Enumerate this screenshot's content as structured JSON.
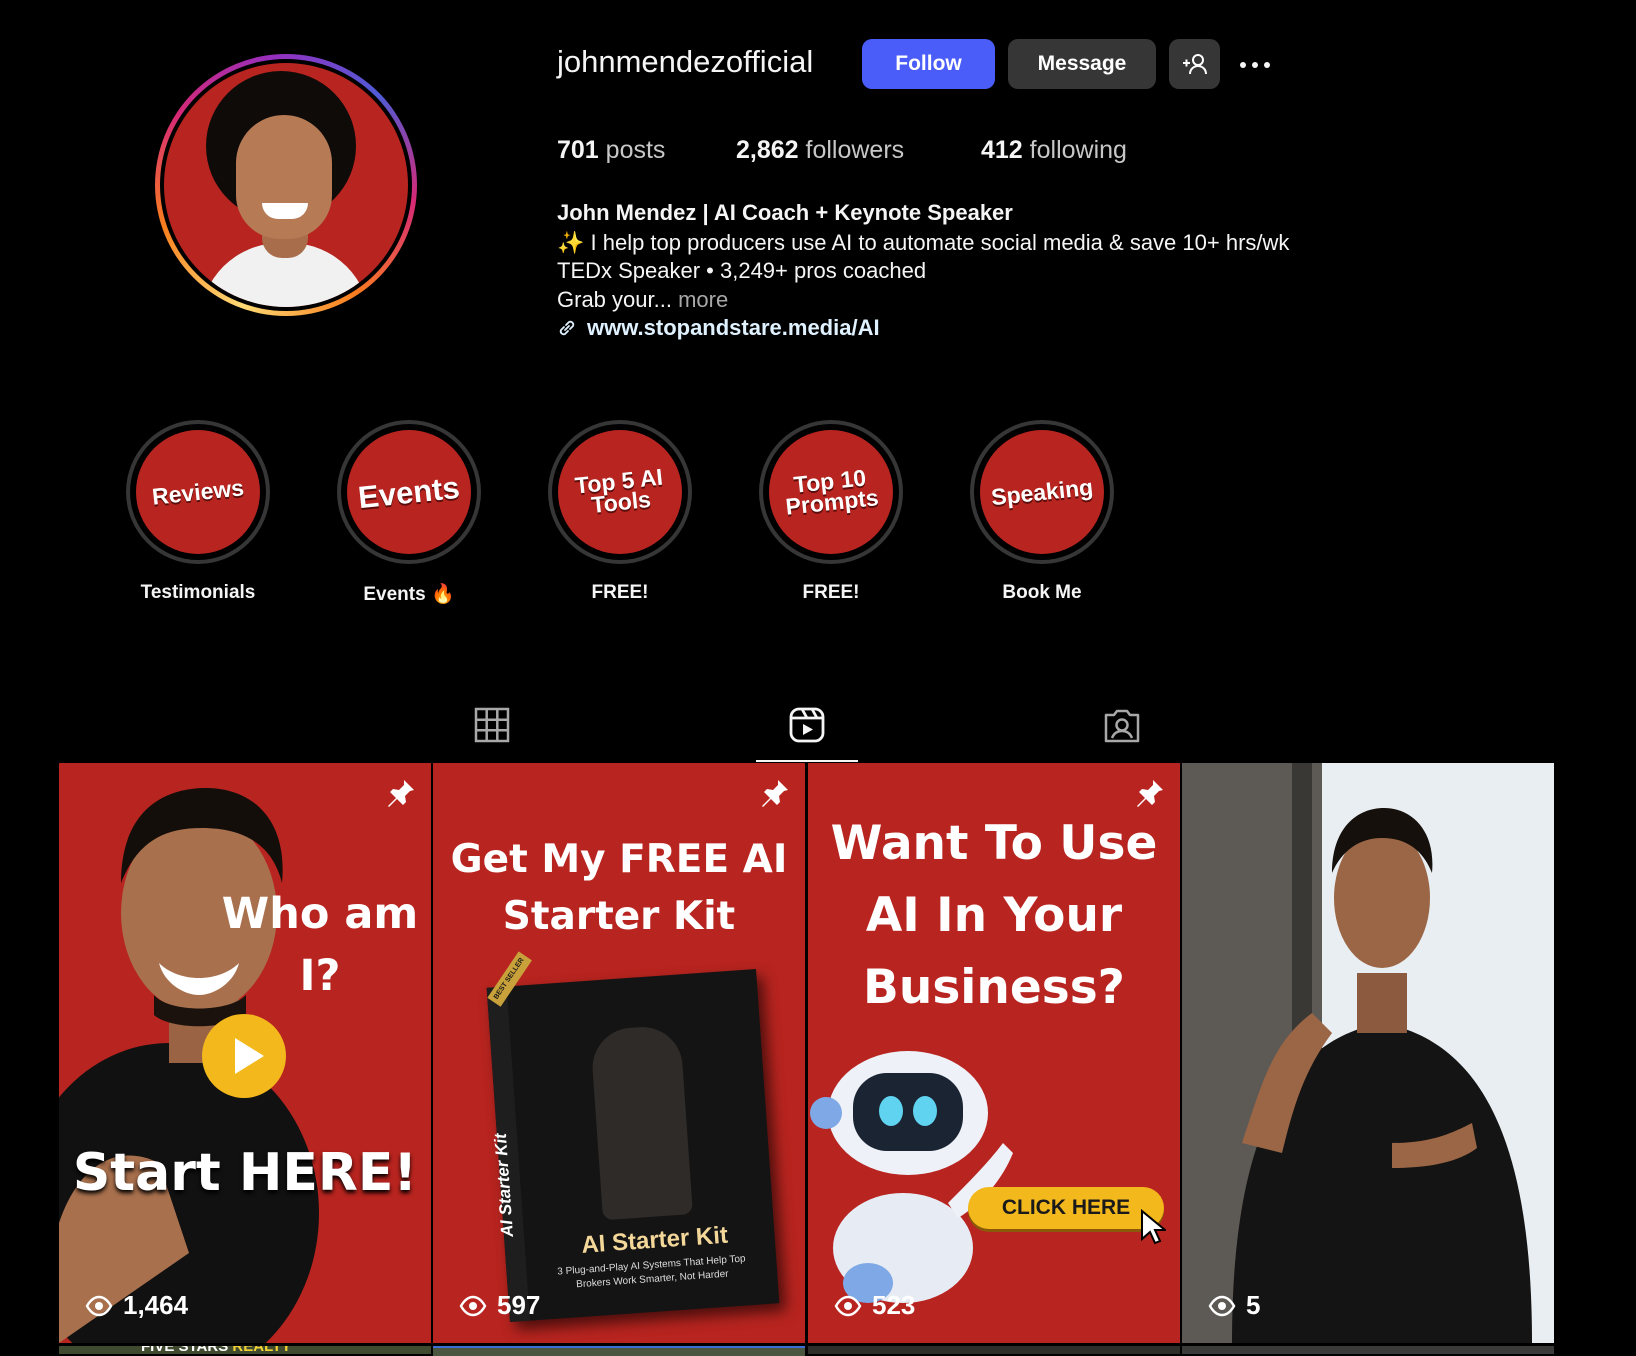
{
  "profile": {
    "username": "johnmendezofficial",
    "follow_label": "Follow",
    "message_label": "Message",
    "add_user_icon": "add-user-icon",
    "more_icon": "more-options-icon"
  },
  "stats": {
    "posts_count": "701",
    "posts_label": "posts",
    "followers_count": "2,862",
    "followers_label": "followers",
    "following_count": "412",
    "following_label": "following"
  },
  "bio": {
    "name": "John Mendez | AI Coach + Keynote Speaker",
    "line1": "✨ I help top producers use AI to automate social media & save 10+ hrs/wk",
    "line2": "TEDx Speaker • 3,249+ pros coached",
    "line3": "Grab your...",
    "more": "more",
    "link": "www.stopandstare.media/AI"
  },
  "highlights": [
    {
      "cover": "Reviews",
      "label": "Testimonials"
    },
    {
      "cover": "Events",
      "label": "Events 🔥"
    },
    {
      "cover": "Top 5 AI Tools",
      "label": "FREE!"
    },
    {
      "cover": "Top 10 Prompts",
      "label": "FREE!"
    },
    {
      "cover": "Speaking",
      "label": "Book Me"
    }
  ],
  "tabs": {
    "posts_icon": "grid-icon",
    "reels_icon": "reels-icon",
    "tagged_icon": "tagged-icon",
    "active": "reels"
  },
  "reels": [
    {
      "title_top": "Who am I?",
      "title_bottom": "Start HERE!",
      "views": "1,464",
      "pinned": true
    },
    {
      "title_top": "Get My FREE AI Starter Kit",
      "book_title": "AI Starter Kit",
      "book_spine": "AI Starter Kit",
      "book_badge": "BEST SELLER",
      "book_sub": "3 Plug-and-Play AI Systems That Help Top Brokers Work Smarter, Not Harder",
      "views": "597",
      "pinned": true
    },
    {
      "title_top": "Want To Use AI In Your Business?",
      "cta": "CLICK HERE",
      "views": "523",
      "pinned": true
    },
    {
      "views": "5",
      "pinned": false
    }
  ],
  "row2_partial_text": "FIVE STARS",
  "row2_partial_text_accent": "REALTY",
  "colors": {
    "follow_blue": "#4a5df9",
    "brand_red": "#b8241f",
    "button_gray": "#363636",
    "cta_yellow": "#f3b81b"
  }
}
